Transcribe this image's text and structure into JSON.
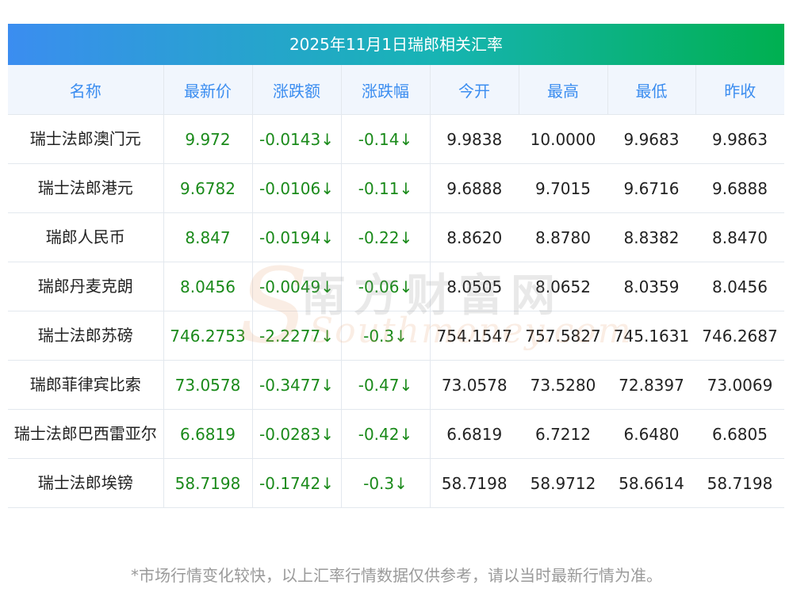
{
  "title": "2025年11月1日瑞郎相关汇率",
  "headers": [
    "名称",
    "最新价",
    "涨跌额",
    "涨跌幅",
    "今开",
    "最高",
    "最低",
    "昨收"
  ],
  "rows": [
    {
      "name": "瑞士法郎澳门元",
      "latest": "9.972",
      "change": "-0.0143↓",
      "pct": "-0.14↓",
      "open": "9.9838",
      "high": "10.0000",
      "low": "9.9683",
      "prev": "9.9863"
    },
    {
      "name": "瑞士法郎港元",
      "latest": "9.6782",
      "change": "-0.0106↓",
      "pct": "-0.11↓",
      "open": "9.6888",
      "high": "9.7015",
      "low": "9.6716",
      "prev": "9.6888"
    },
    {
      "name": "瑞郎人民币",
      "latest": "8.847",
      "change": "-0.0194↓",
      "pct": "-0.22↓",
      "open": "8.8620",
      "high": "8.8780",
      "low": "8.8382",
      "prev": "8.8470"
    },
    {
      "name": "瑞郎丹麦克朗",
      "latest": "8.0456",
      "change": "-0.0049↓",
      "pct": "-0.06↓",
      "open": "8.0505",
      "high": "8.0652",
      "low": "8.0359",
      "prev": "8.0456"
    },
    {
      "name": "瑞士法郎苏磅",
      "latest": "746.2753",
      "change": "-2.2277↓",
      "pct": "-0.3↓",
      "open": "754.1547",
      "high": "757.5827",
      "low": "745.1631",
      "prev": "746.2687"
    },
    {
      "name": "瑞郎菲律宾比索",
      "latest": "73.0578",
      "change": "-0.3477↓",
      "pct": "-0.47↓",
      "open": "73.0578",
      "high": "73.5280",
      "low": "72.8397",
      "prev": "73.0069"
    },
    {
      "name": "瑞士法郎巴西雷亚尔",
      "latest": "6.6819",
      "change": "-0.0283↓",
      "pct": "-0.42↓",
      "open": "6.6819",
      "high": "6.7212",
      "low": "6.6480",
      "prev": "6.6805"
    },
    {
      "name": "瑞士法郎埃镑",
      "latest": "58.7198",
      "change": "-0.1742↓",
      "pct": "-0.3↓",
      "open": "58.7198",
      "high": "58.9712",
      "low": "58.6614",
      "prev": "58.7198"
    }
  ],
  "watermark": {
    "cn": "南方财富网",
    "en": "Southmoney.com",
    "s": "S"
  },
  "footnote": "*市场行情变化较快，以上汇率行情数据仅供参考，请以当时最新行情为准。",
  "colors": {
    "header_text": "#3b8df0",
    "up_down_green": "#1a8a1a",
    "title_gradient_start": "#3b8df0",
    "title_gradient_end": "#00b050"
  }
}
